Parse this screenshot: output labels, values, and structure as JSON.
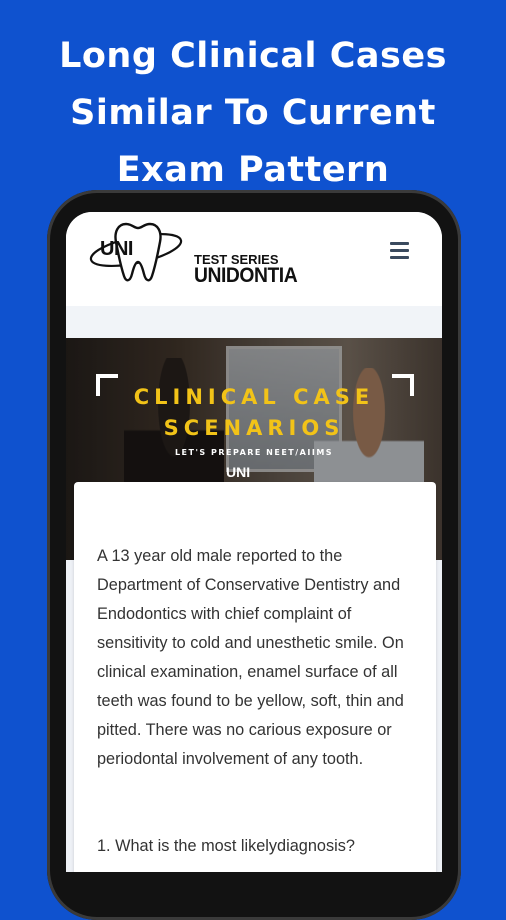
{
  "headline": {
    "line1": "Long Clinical Cases",
    "line2": "Similar To Current",
    "line3": "Exam Pattern"
  },
  "colors": {
    "background": "#0f52cf",
    "banner_title": "#f2c318"
  },
  "app": {
    "logo": {
      "mark": "UNI",
      "tagline": "TEST SERIES",
      "name": "UNIDONTIA"
    },
    "menu_icon": "hamburger-menu-icon",
    "banner": {
      "title_line1": "CLINICAL CASE",
      "title_line2": "SCENARIOS",
      "subtitle": "LET'S PREPARE NEET/AIIMS",
      "logo_text": "UNI"
    },
    "case": {
      "text": "A 13 year old male reported to the Department of Conservative Dentistry and Endodontics with chief complaint of sensitivity to cold and unesthetic smile. On clinical examination, enamel surface of all teeth was found to be yellow, soft, thin and pitted. There was no carious exposure or periodontal involvement of any tooth.",
      "question": "1. What is the most likelydiagnosis?"
    }
  }
}
